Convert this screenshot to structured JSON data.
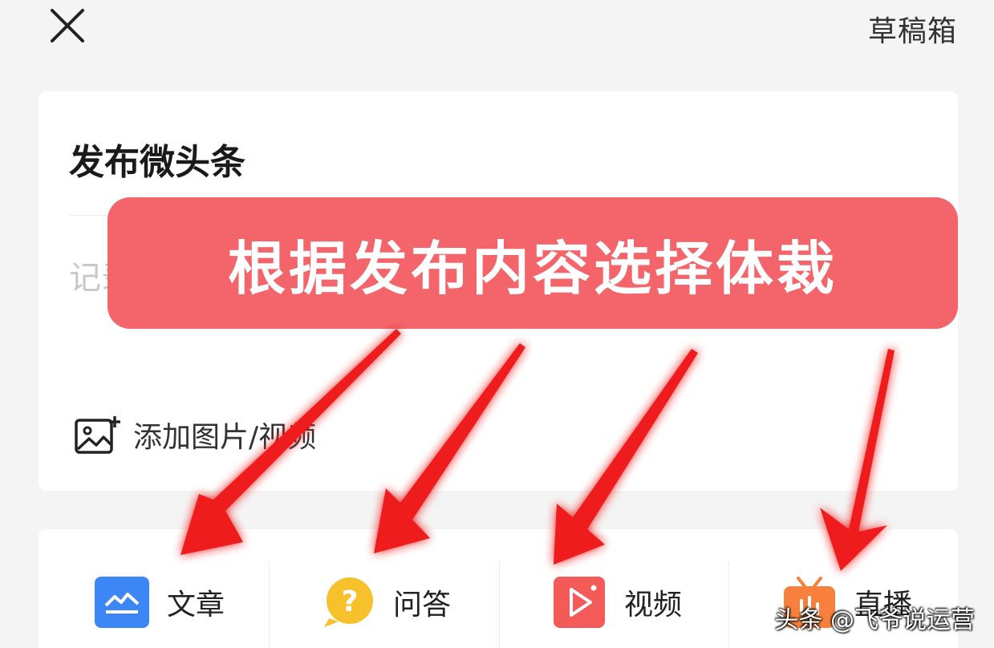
{
  "header": {
    "close_icon": "close-icon",
    "drafts_label": "草稿箱"
  },
  "compose": {
    "title": "发布微头条",
    "body_placeholder": "记录",
    "add_media_label": "添加图片/视频",
    "add_media_icon": "image-add-icon"
  },
  "post_types": [
    {
      "label": "文章",
      "icon": "article-icon",
      "color": "#3d86f5"
    },
    {
      "label": "问答",
      "icon": "question-icon",
      "color": "#f7c12c"
    },
    {
      "label": "视频",
      "icon": "video-play-icon",
      "color": "#f35a58"
    },
    {
      "label": "直播",
      "icon": "live-tv-icon",
      "color": "#f7813c"
    }
  ],
  "annotation": {
    "banner_text": "根据发布内容选择体裁",
    "banner_color": "#f3656a",
    "arrow_color": "#ee1c1c"
  },
  "watermark": "头条 @飞爷说运营"
}
